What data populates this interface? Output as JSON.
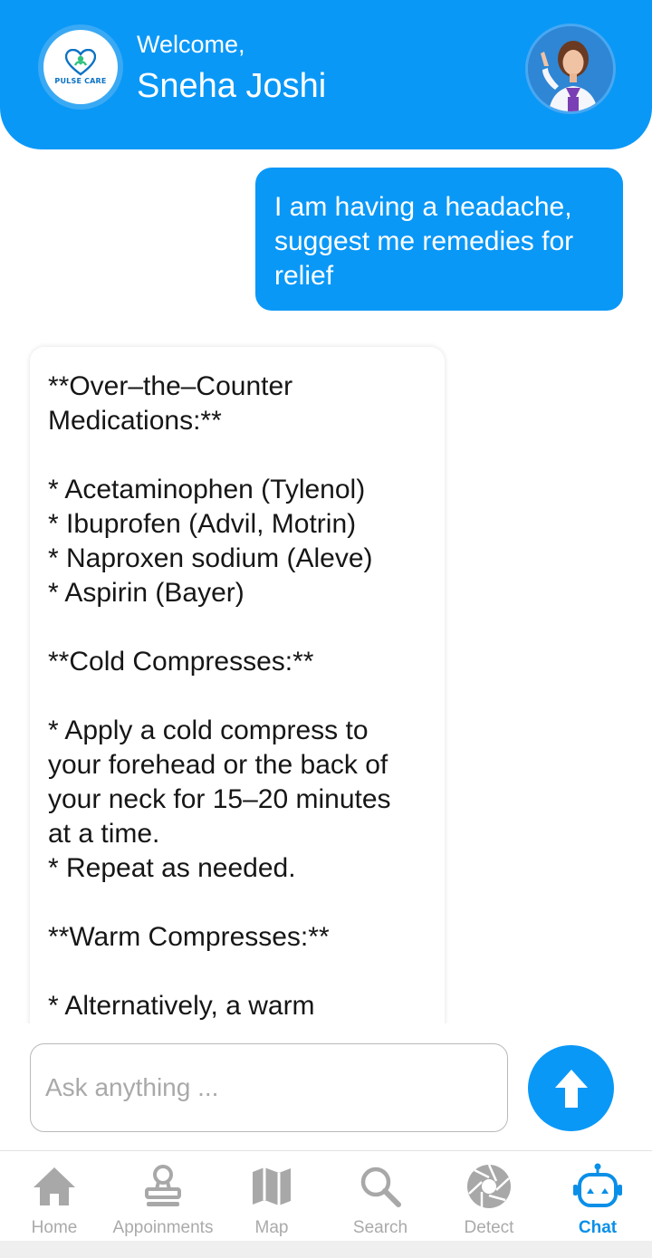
{
  "header": {
    "logo_text": "PULSE CARE",
    "welcome": "Welcome,",
    "username": "Sneha Joshi",
    "avatar_icon": "doctor-avatar"
  },
  "chat": {
    "user_message": "I am having a headache, suggest me remedies for relief",
    "bot_lines": [
      "**Over–the–Counter",
      "Medications:**",
      "",
      "* Acetaminophen (Tylenol)",
      "* Ibuprofen (Advil, Motrin)",
      "* Naproxen sodium (Aleve)",
      "* Aspirin (Bayer)",
      "",
      "**Cold Compresses:**",
      "",
      "* Apply a cold compress to",
      "your forehead or the back of",
      "your neck for 15–20 minutes",
      "at a time.",
      "* Repeat as needed.",
      "",
      "**Warm Compresses:**",
      "",
      "* Alternatively, a warm"
    ]
  },
  "composer": {
    "placeholder": "Ask anything ...",
    "send_icon": "arrow-up-icon"
  },
  "nav": {
    "items": [
      {
        "label": "Home",
        "icon": "home-icon"
      },
      {
        "label": "Appoinments",
        "icon": "stamp-icon"
      },
      {
        "label": "Map",
        "icon": "map-icon"
      },
      {
        "label": "Search",
        "icon": "search-icon"
      },
      {
        "label": "Detect",
        "icon": "aperture-icon"
      },
      {
        "label": "Chat",
        "icon": "robot-icon"
      }
    ],
    "active": "Chat"
  },
  "colors": {
    "primary": "#0a98f7",
    "nav_inactive": "#aaaaaa",
    "nav_active": "#0a8fe8"
  }
}
